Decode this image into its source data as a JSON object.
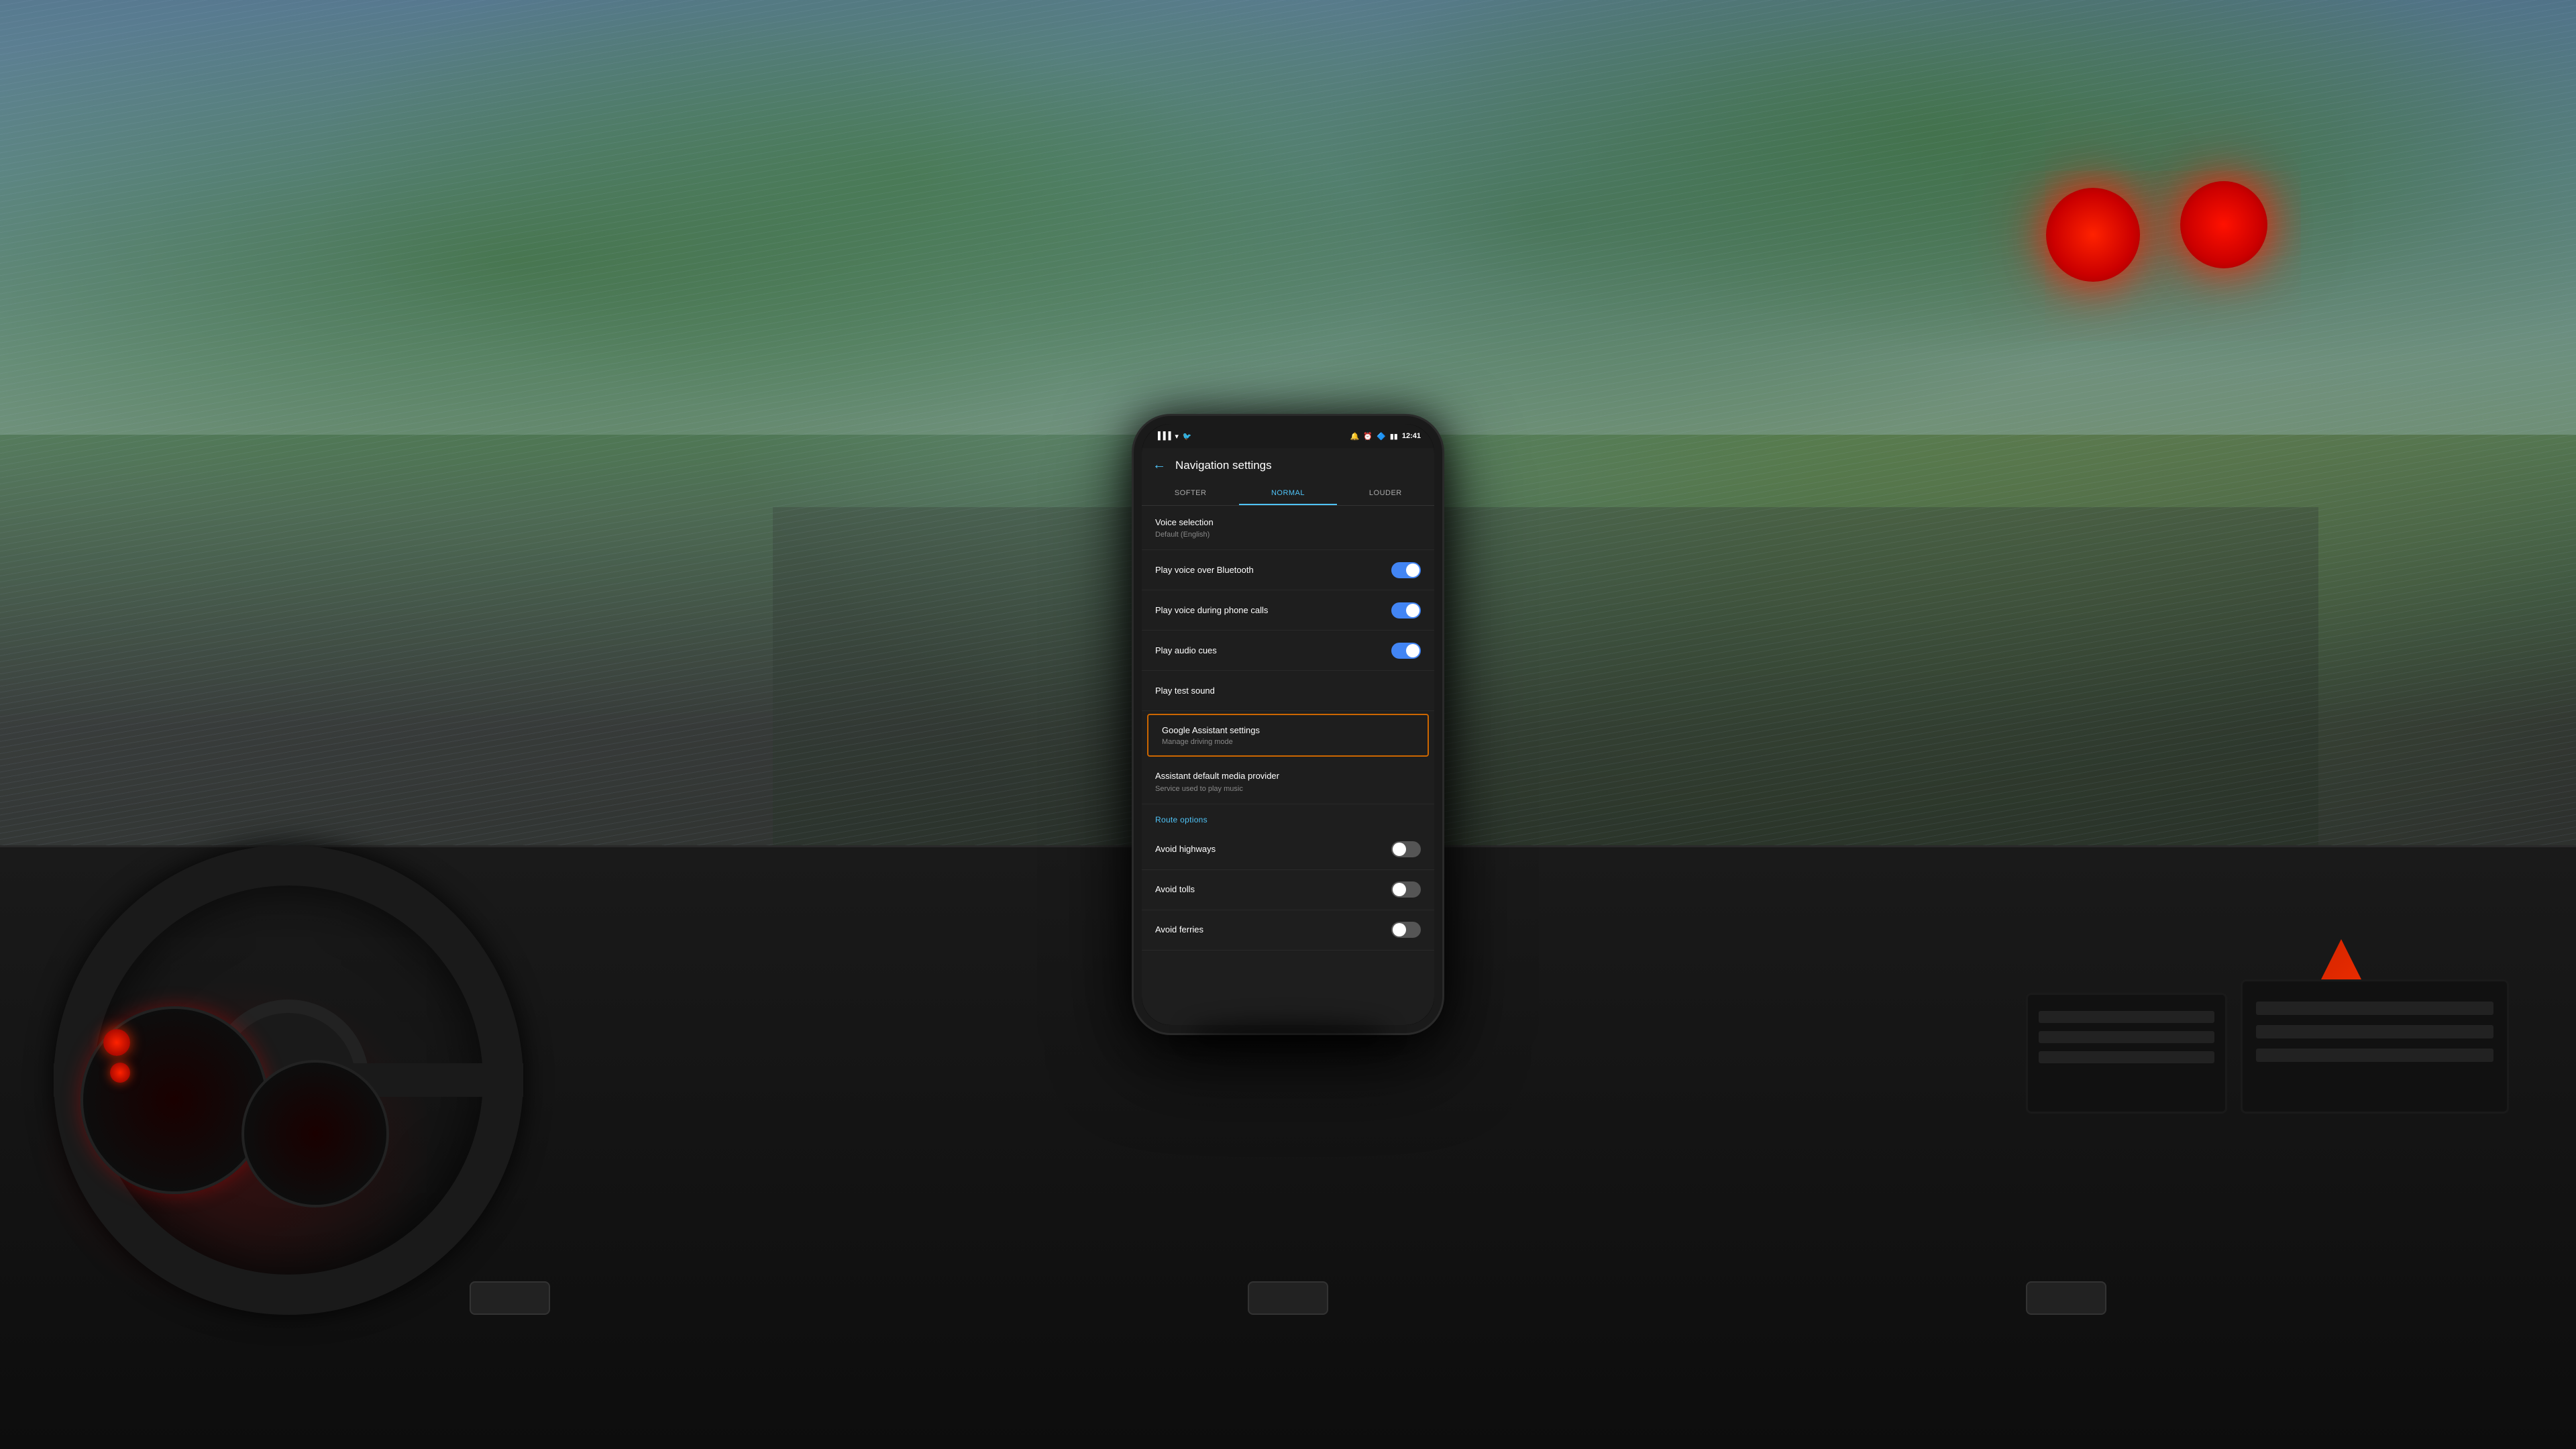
{
  "background": {
    "sky_color": "#5a8aaa",
    "road_color": "#4a5a4a"
  },
  "phone": {
    "status_bar": {
      "time": "12:41",
      "signal_icon": "▐▐▐",
      "wifi_icon": "▾",
      "battery_icon": "▮▮▮"
    },
    "header": {
      "back_label": "←",
      "title": "Navigation settings"
    },
    "volume_tabs": [
      {
        "label": "SOFTER",
        "active": false
      },
      {
        "label": "NORMAL",
        "active": true
      },
      {
        "label": "LOUDER",
        "active": false
      }
    ],
    "settings": {
      "voice_selection": {
        "label": "Voice selection",
        "sublabel": "Default (English)"
      },
      "play_voice_bluetooth": {
        "label": "Play voice over Bluetooth",
        "toggle": "on"
      },
      "play_voice_calls": {
        "label": "Play voice during phone calls",
        "toggle": "on"
      },
      "play_audio_cues": {
        "label": "Play audio cues",
        "toggle": "on"
      },
      "play_test_sound": {
        "label": "Play test sound"
      },
      "google_assistant": {
        "label": "Google Assistant settings",
        "sublabel": "Manage driving mode",
        "highlighted": true
      },
      "assistant_media": {
        "label": "Assistant default media provider",
        "sublabel": "Service used to play music"
      },
      "route_options": {
        "section_label": "Route options",
        "avoid_highways": {
          "label": "Avoid highways",
          "toggle": "off"
        },
        "avoid_tolls": {
          "label": "Avoid tolls",
          "toggle": "off"
        },
        "avoid_ferries": {
          "label": "Avoid ferries",
          "toggle": "off"
        }
      }
    }
  }
}
